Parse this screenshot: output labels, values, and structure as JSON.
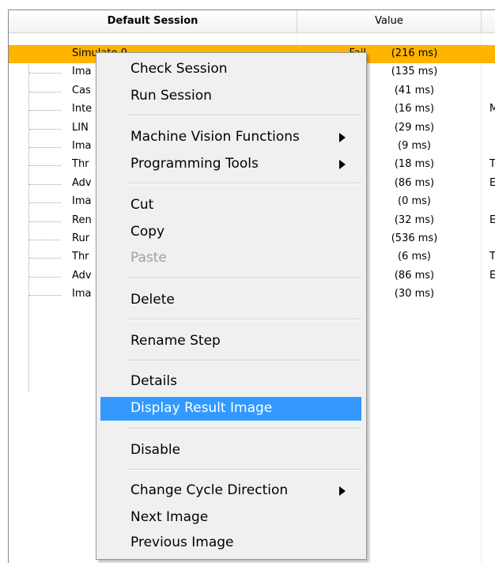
{
  "header": {
    "session": "Default Session",
    "value": "Value"
  },
  "rows": [
    {
      "name": "Simulate 0",
      "status": "Fail",
      "timing": "(216 ms)",
      "extra": ""
    },
    {
      "name": "Ima",
      "status": "",
      "timing": "(135 ms)",
      "extra": ""
    },
    {
      "name": "Cas",
      "status": "",
      "timing": "(41 ms)",
      "extra": ""
    },
    {
      "name": "Inte",
      "status": "",
      "timing": "(16 ms)",
      "extra": "M"
    },
    {
      "name": "LIN",
      "status": "",
      "timing": "(29 ms)",
      "extra": ""
    },
    {
      "name": "Ima",
      "status": "",
      "timing": "(9 ms)",
      "extra": ""
    },
    {
      "name": "Thr",
      "status": "",
      "timing": "(18 ms)",
      "extra": "T"
    },
    {
      "name": "Adv",
      "status": "",
      "timing": "(86 ms)",
      "extra": "E"
    },
    {
      "name": "Ima",
      "status": "",
      "timing": "(0 ms)",
      "extra": ""
    },
    {
      "name": "Ren",
      "status": "",
      "timing": "(32 ms)",
      "extra": "E"
    },
    {
      "name": "Rur",
      "status": "",
      "timing": "(536 ms)",
      "extra": ""
    },
    {
      "name": "Thr",
      "status": "",
      "timing": "(6 ms)",
      "extra": "T"
    },
    {
      "name": "Adv",
      "status": "",
      "timing": "(86 ms)",
      "extra": "E"
    },
    {
      "name": "Ima",
      "status": "",
      "timing": "(30 ms)",
      "extra": ""
    }
  ],
  "menu": {
    "check_session": "Check Session",
    "run_session": "Run Session",
    "machine_vision": "Machine Vision Functions",
    "programming_tools": "Programming Tools",
    "cut": "Cut",
    "copy": "Copy",
    "paste": "Paste",
    "delete": "Delete",
    "rename_step": "Rename Step",
    "details": "Details",
    "display_result_image": "Display Result Image",
    "disable": "Disable",
    "change_cycle_direction": "Change Cycle Direction",
    "next_image": "Next Image",
    "previous_image": "Previous Image"
  },
  "colors": {
    "selected_row": "#ffb400",
    "menu_highlight": "#3399ff",
    "menu_bg": "#f0f0f0"
  },
  "icons": {
    "submenu": "submenu-arrow-icon",
    "tree": "tree-connector-icon"
  }
}
